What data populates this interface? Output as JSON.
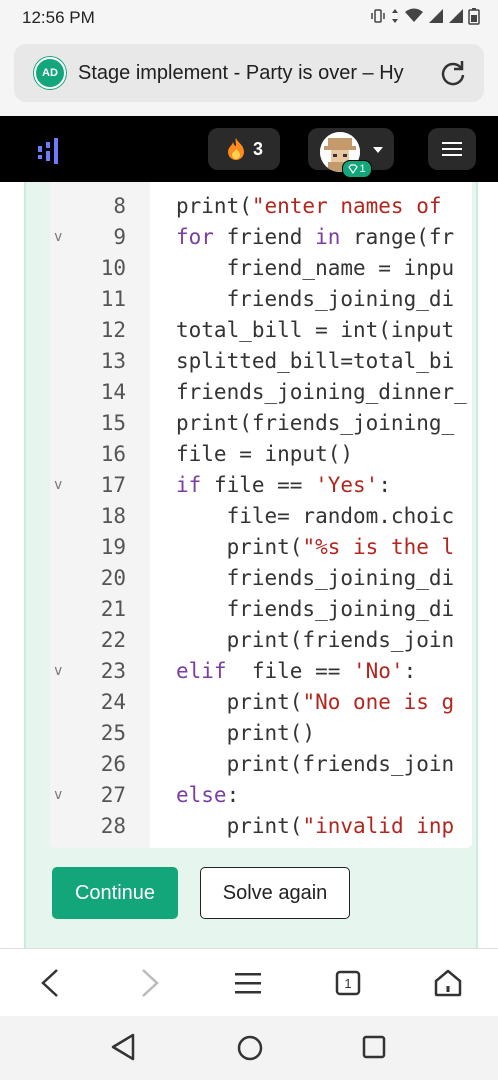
{
  "status_bar": {
    "time": "12:56 PM"
  },
  "browser": {
    "ad_badge": "AD",
    "page_title": "Stage implement - Party is over – Hy",
    "tab_count": "1"
  },
  "header": {
    "streak_count": "3",
    "avatar_badge_count": "1"
  },
  "code_lines": [
    {
      "ln": "8",
      "fold": false,
      "html": "print(\"enter names of "
    },
    {
      "ln": "9",
      "fold": true,
      "html": "for friend in range(fr"
    },
    {
      "ln": "10",
      "fold": false,
      "html": "    friend_name = inpu"
    },
    {
      "ln": "11",
      "fold": false,
      "html": "    friends_joining_di"
    },
    {
      "ln": "12",
      "fold": false,
      "html": "total_bill = int(input"
    },
    {
      "ln": "13",
      "fold": false,
      "html": "splitted_bill=total_bi"
    },
    {
      "ln": "14",
      "fold": false,
      "html": "friends_joining_dinner_"
    },
    {
      "ln": "15",
      "fold": false,
      "html": "print(friends_joining_"
    },
    {
      "ln": "16",
      "fold": false,
      "html": "file = input()"
    },
    {
      "ln": "17",
      "fold": true,
      "html": "if file == 'Yes':"
    },
    {
      "ln": "18",
      "fold": false,
      "html": "    file= random.choic"
    },
    {
      "ln": "19",
      "fold": false,
      "html": "    print(\"%s is the l"
    },
    {
      "ln": "20",
      "fold": false,
      "html": "    friends_joining_di"
    },
    {
      "ln": "21",
      "fold": false,
      "html": "    friends_joining_di"
    },
    {
      "ln": "22",
      "fold": false,
      "html": "    print(friends_join"
    },
    {
      "ln": "23",
      "fold": true,
      "html": "elif  file == 'No':"
    },
    {
      "ln": "24",
      "fold": false,
      "html": "    print(\"No one is g"
    },
    {
      "ln": "25",
      "fold": false,
      "html": "    print()"
    },
    {
      "ln": "26",
      "fold": false,
      "html": "    print(friends_join"
    },
    {
      "ln": "27",
      "fold": true,
      "html": "else:"
    },
    {
      "ln": "28",
      "fold": false,
      "html": "    print(\"invalid inp"
    }
  ],
  "buttons": {
    "continue": "Continue",
    "solve_again": "Solve again"
  },
  "colors": {
    "accent": "#13a67b",
    "keyword": "#7a3ea1",
    "string": "#b3261e"
  }
}
